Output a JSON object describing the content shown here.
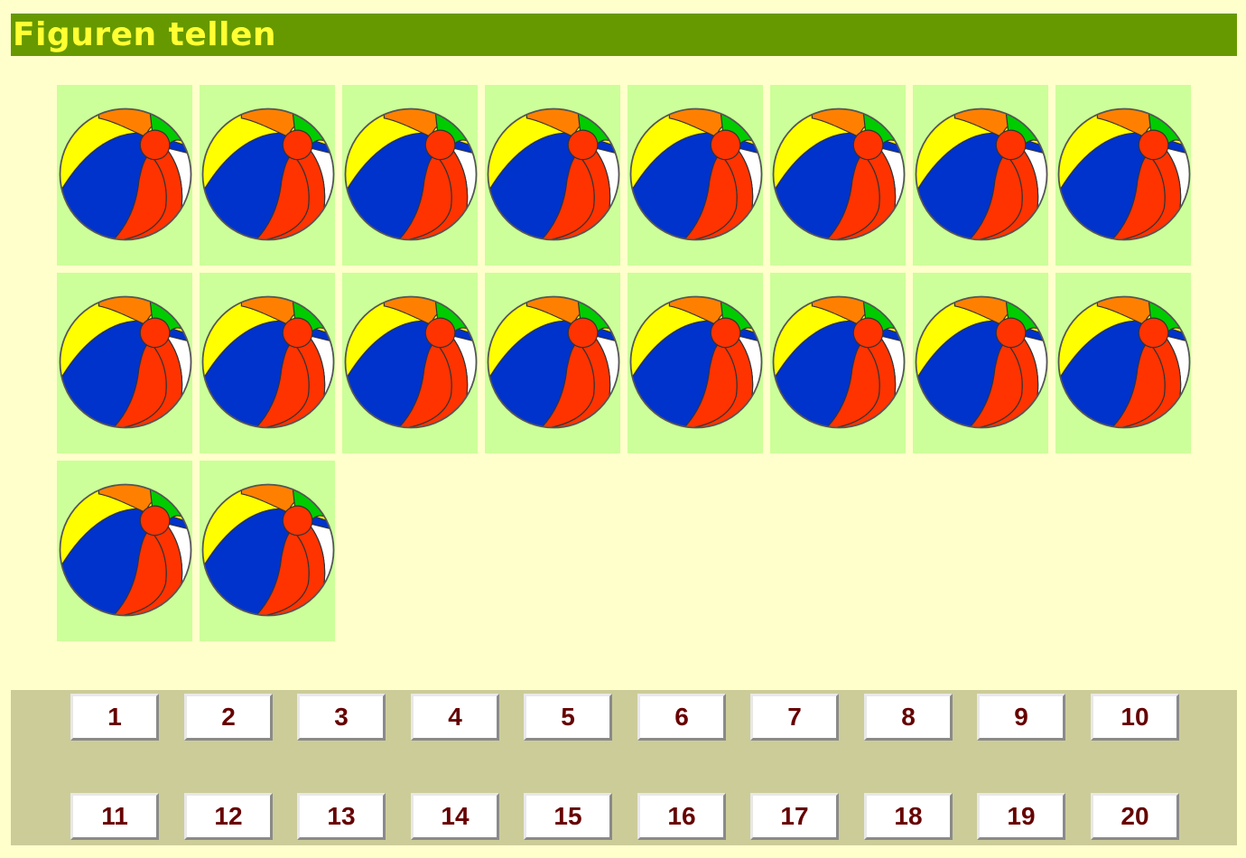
{
  "title": "Figuren tellen",
  "figures": {
    "count": 18,
    "icon": "beach-ball-icon",
    "colors": {
      "tile": "#ccff99",
      "ball_yellow": "#ffff00",
      "ball_blue": "#0033cc",
      "ball_red": "#ff3300",
      "ball_orange": "#ff8000",
      "ball_green": "#00cc00",
      "ball_white": "#ffffff"
    }
  },
  "answers": {
    "buttons": [
      "1",
      "2",
      "3",
      "4",
      "5",
      "6",
      "7",
      "8",
      "9",
      "10",
      "11",
      "12",
      "13",
      "14",
      "15",
      "16",
      "17",
      "18",
      "19",
      "20"
    ]
  },
  "colors": {
    "page_background": "#ffffcc",
    "title_bar": "#669900",
    "title_text": "#ffff33",
    "answer_panel": "#cccc99",
    "button_text": "#660000"
  }
}
